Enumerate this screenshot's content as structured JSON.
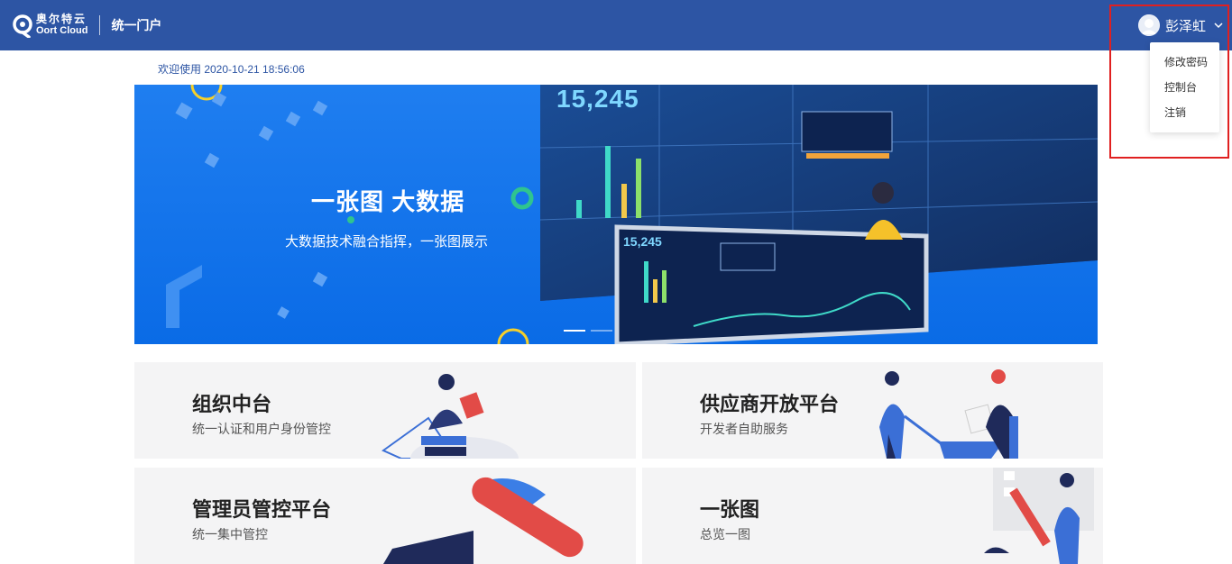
{
  "header": {
    "logo_cn": "奥尔特云",
    "logo_en": "Oort Cloud",
    "portal_title": "统一门户",
    "username": "彭泽虹"
  },
  "user_menu": {
    "items": [
      {
        "label": "修改密码"
      },
      {
        "label": "控制台"
      },
      {
        "label": "注销"
      }
    ]
  },
  "welcome": "欢迎使用 2020-10-21 18:56:06",
  "banner": {
    "title": "一张图  大数据",
    "subtitle": "大数据技术融合指挥，一张图展示",
    "screen_number": "15,245"
  },
  "cards": [
    {
      "title": "组织中台",
      "desc": "统一认证和用户身份管控"
    },
    {
      "title": "供应商开放平台",
      "desc": "开发者自助服务"
    },
    {
      "title": "管理员管控平台",
      "desc": "统一集中管控"
    },
    {
      "title": "一张图",
      "desc": "总览一图"
    }
  ],
  "colors": {
    "header_bg": "#2d55a4",
    "banner_bg": "#1a78ee",
    "highlight": "#e02020",
    "card_bg": "#f4f4f5"
  }
}
